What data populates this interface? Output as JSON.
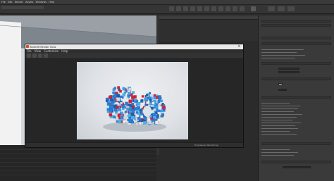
{
  "menubar": {
    "items": [
      "File",
      "Edit",
      "Render",
      "Assets",
      "Windows",
      "Help"
    ]
  },
  "render_window": {
    "title": "Redshift Render View",
    "menu": [
      "File",
      "View",
      "Customize",
      "Help"
    ],
    "close_glyph": "×",
    "status_text": "Progressive Rendering"
  },
  "icons": {
    "shelf": "shelf-tool-icon",
    "close": "close-icon"
  },
  "colors": {
    "accent": "#c9522c",
    "bg": "#2b2b2b",
    "panel": "#3a3a3a"
  }
}
